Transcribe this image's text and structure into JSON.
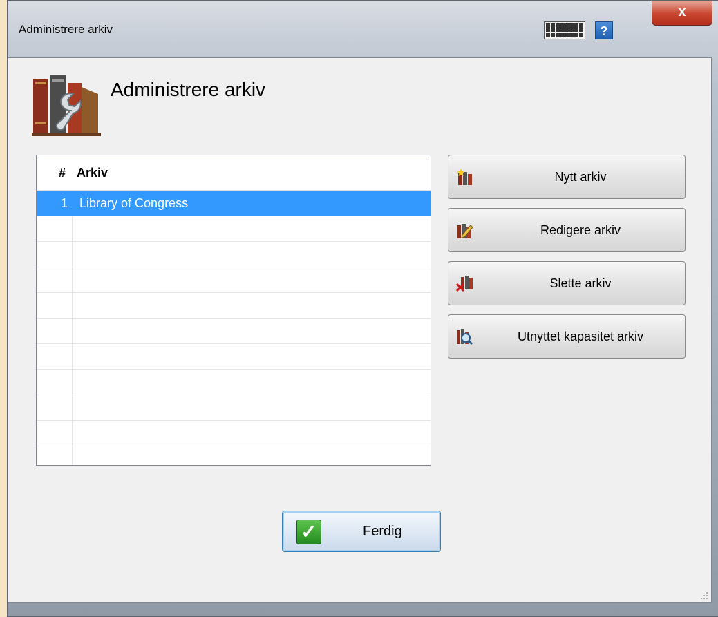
{
  "window": {
    "title": "Administrere arkiv",
    "close_label": "x",
    "help_label": "?",
    "keyboard_icon": "keyboard-icon",
    "help_icon": "help-icon"
  },
  "header": {
    "title": "Administrere arkiv",
    "icon": "archive-tools-icon"
  },
  "list": {
    "columns": {
      "number": "#",
      "name": "Arkiv"
    },
    "rows": [
      {
        "number": "1",
        "name": "Library of Congress",
        "selected": true
      }
    ]
  },
  "actions": {
    "new": {
      "label": "Nytt arkiv",
      "icon": "new-archive-icon"
    },
    "edit": {
      "label": "Redigere arkiv",
      "icon": "edit-archive-icon"
    },
    "delete": {
      "label": "Slette arkiv",
      "icon": "delete-archive-icon"
    },
    "capacity": {
      "label": "Utnyttet kapasitet arkiv",
      "icon": "capacity-search-icon"
    }
  },
  "done": {
    "label": "Ferdig",
    "icon": "checkmark-icon"
  },
  "colors": {
    "selection": "#3399ff",
    "close_button": "#c9452f",
    "done_border": "#3c7fb1"
  }
}
